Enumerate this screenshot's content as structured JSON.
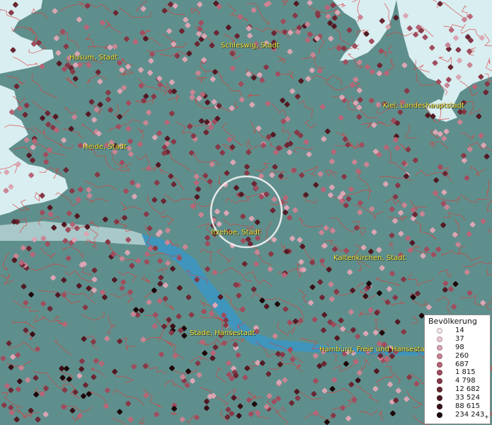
{
  "map": {
    "cities": [
      {
        "name": "Husum, Stadt"
      },
      {
        "name": "Schleswig, Stadt"
      },
      {
        "name": "Kiel, Landeshauptstadt"
      },
      {
        "name": "Heide, Stadt"
      },
      {
        "name": "Itzehoe, Stadt"
      },
      {
        "name": "Kaltenkirchen, Stadt"
      },
      {
        "name": "Stade, Hansestadt"
      },
      {
        "name": "Hamburg, Freie und Hansestadt"
      }
    ],
    "colors": {
      "land": "#5f8f8c",
      "water": "#d8eef1",
      "river": "#3a97c4",
      "boundary": "#e23a3a",
      "label": "#ffef3a"
    }
  },
  "legend": {
    "title": "Bevölkerung",
    "items": [
      {
        "label": "14",
        "color": "#f6e6ec"
      },
      {
        "label": "37",
        "color": "#ebc7d1"
      },
      {
        "label": "98",
        "color": "#dba6b4"
      },
      {
        "label": "260",
        "color": "#c98594"
      },
      {
        "label": "687",
        "color": "#b76577"
      },
      {
        "label": "1 815",
        "color": "#a04d5e"
      },
      {
        "label": "4 798",
        "color": "#873947"
      },
      {
        "label": "12 682",
        "color": "#6b2733"
      },
      {
        "label": "33 524",
        "color": "#521a24"
      },
      {
        "label": "88 615",
        "color": "#3a1017"
      },
      {
        "label": "234 243",
        "color": "#1d0609"
      }
    ],
    "overflow_mark": "+"
  }
}
